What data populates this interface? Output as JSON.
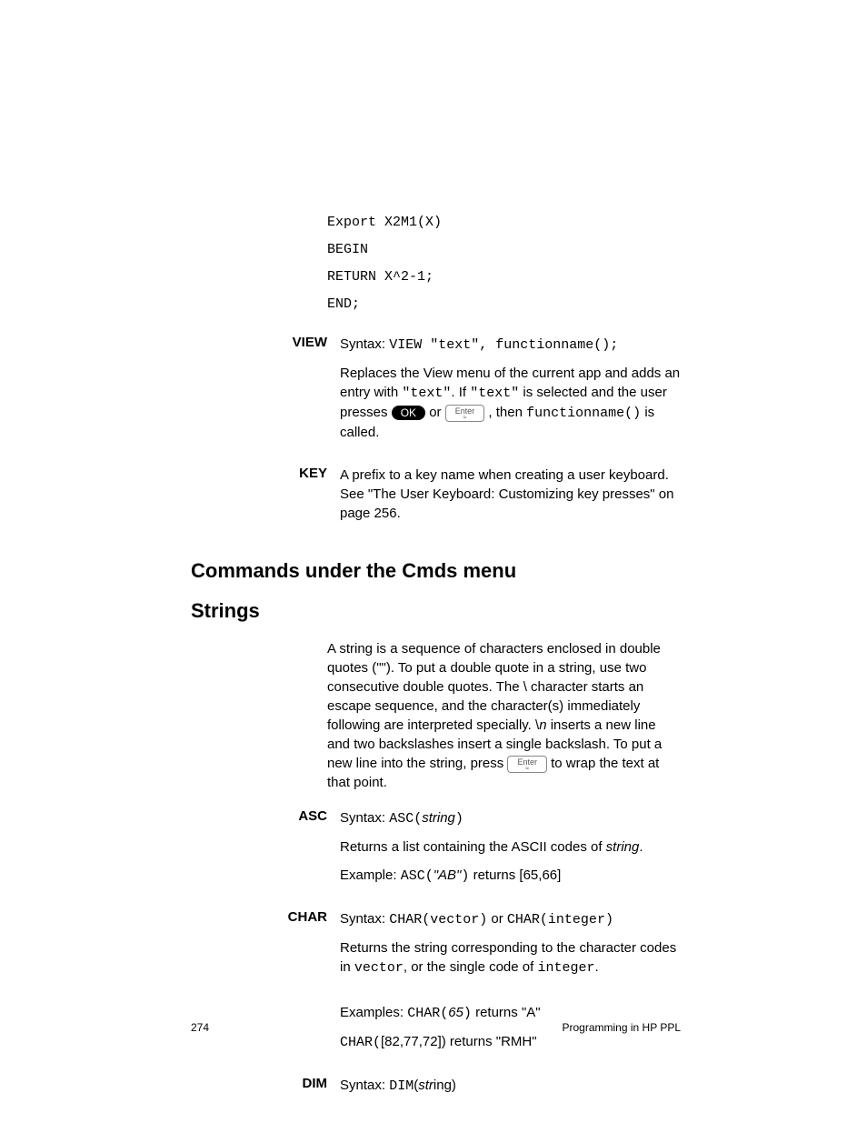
{
  "code": {
    "l1": "Export X2M1(X)",
    "l2": "BEGIN",
    "l3": "RETURN X^2-1;",
    "l4": "END;"
  },
  "view": {
    "term": "VIEW",
    "syntax_label": "Syntax: ",
    "syntax": "VIEW \"text\", functionname();",
    "desc1a": "Replaces the View menu of the current app and adds an entry with ",
    "desc1b": "\"text\"",
    "desc1c": ". If ",
    "desc1d": "\"text\"",
    "desc1e": " is selected and the user presses ",
    "ok": "OK",
    "or": " or ",
    "enter_top": "Enter",
    "enter_sub": "≈",
    "then": " , then ",
    "fn": "functionname()",
    "desc1f": " is called."
  },
  "key": {
    "term": "KEY",
    "desc": "A prefix to a key name when creating a user keyboard. See \"The User Keyboard: Customizing key presses\" on page 256."
  },
  "headings": {
    "cmds": "Commands under the Cmds menu",
    "strings": "Strings"
  },
  "strings_intro": {
    "p1a": "A string is a sequence of characters enclosed in double quotes (\"\"). To put a double quote in a string, use two consecutive double quotes. The \\ character starts an escape sequence, and the character(s) immediately following are interpreted specially. \\",
    "p1b": "n",
    "p1c": " inserts a new line and two backslashes insert a single backslash. To put a new line into the string, press ",
    "p1d": " to wrap the text at that point."
  },
  "asc": {
    "term": "ASC",
    "syntax_label": "Syntax: ",
    "syntax1": "ASC(",
    "syntax_arg": "string",
    "syntax2": ")",
    "desc1": "Returns a list containing the ASCII codes of ",
    "desc_arg": "string",
    "desc2": ".",
    "ex_label": "Example: ",
    "ex1": "ASC(",
    "ex_arg": "\"AB\"",
    "ex2": ")",
    "ex3": " returns [65,66]"
  },
  "char": {
    "term": "CHAR",
    "syntax_label": "Syntax: ",
    "syntax1": "CHAR(vector)",
    "or": " or ",
    "syntax2": "CHAR(integer)",
    "desc1": "Returns the string corresponding to the character codes in ",
    "vec": "vector",
    "desc2": ", or the single code of ",
    "intg": "integer",
    "desc3": ".",
    "ex_label": "Examples: ",
    "ex1a": "CHAR(",
    "ex1b": "65",
    "ex1c": ")",
    "ex1d": " returns \"A\"",
    "ex2a": "CHAR(",
    "ex2b": "[82,77,72]) returns \"RMH\""
  },
  "dim": {
    "term": "DIM",
    "syntax_label": "Syntax: ",
    "syntax1": "DIM",
    "syntax2": "(",
    "arg_it": "str",
    "arg_plain": "ing)"
  },
  "footer": {
    "page": "274",
    "title": "Programming in HP PPL"
  }
}
